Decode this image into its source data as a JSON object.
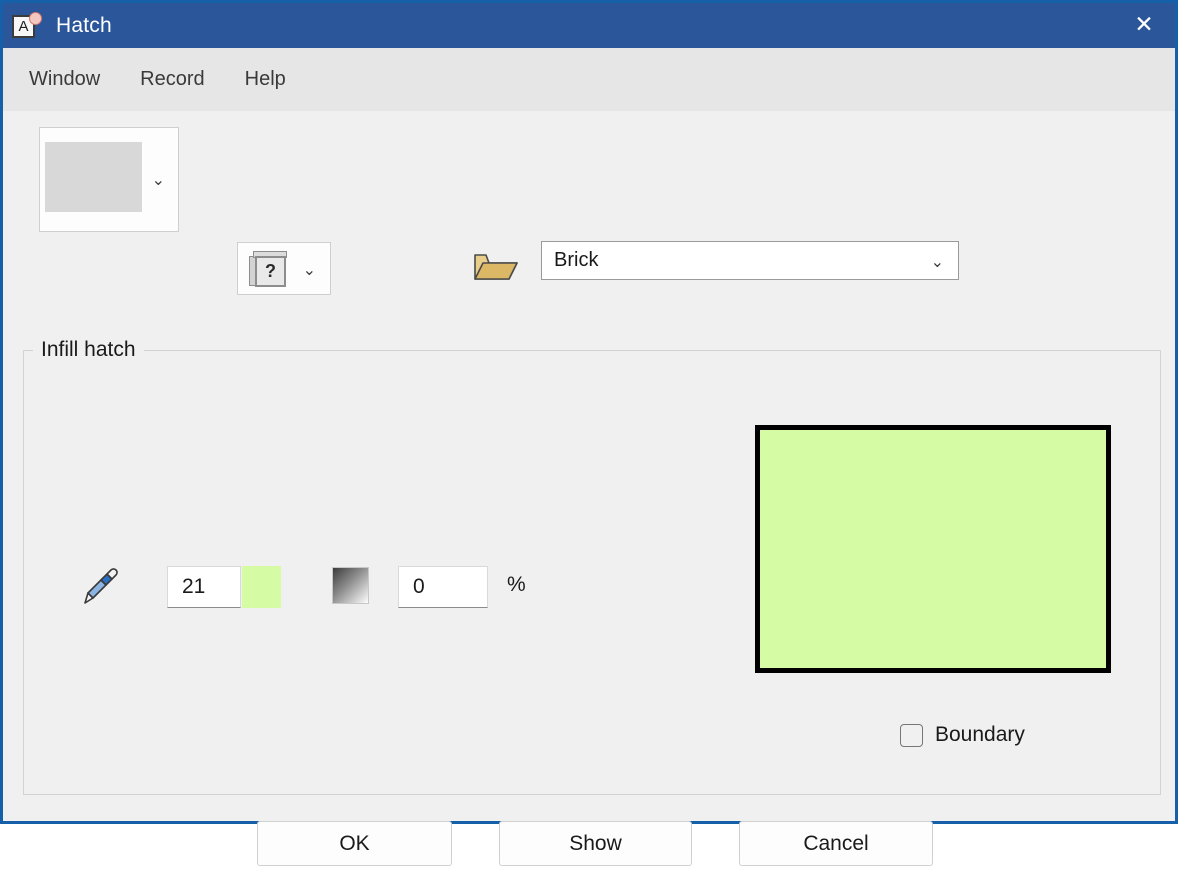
{
  "window": {
    "title": "Hatch",
    "app_icon": "document-a-icon",
    "close_icon": "close-icon",
    "titlebar_color": "#2b579a",
    "border_color": "#1560a8",
    "background_color": "#f0f0f0"
  },
  "menubar": {
    "items": [
      {
        "label": "Window",
        "name": "menu-window"
      },
      {
        "label": "Record",
        "name": "menu-record"
      },
      {
        "label": "Help",
        "name": "menu-help"
      }
    ]
  },
  "toolbar": {
    "pattern_preview_swatch": {
      "icon": "pattern-swatch",
      "color": "#d8d8d8",
      "chevron": "⌄"
    },
    "help_book": {
      "icon": "help-book-icon",
      "glyph": "?",
      "chevron": "⌄"
    },
    "open_folder": {
      "icon": "open-folder-icon",
      "color": "#e0bc6a"
    },
    "pattern_combo": {
      "value": "Brick",
      "chevron": "⌄"
    }
  },
  "infill_group": {
    "legend": "Infill hatch",
    "pencil_icon": "pencil-icon",
    "line_number": {
      "value": "21",
      "name": "line-number-input"
    },
    "line_color": {
      "icon": "color-swatch",
      "color": "#d5fca5"
    },
    "gradient": {
      "icon": "gradient-swatch",
      "from": "#3c3c3c",
      "to": "#fdfdfd"
    },
    "percent_value": {
      "value": "0",
      "name": "percent-input"
    },
    "percent_label": "%",
    "preview": {
      "fill_color": "#d5fca5",
      "border_color": "#000000"
    },
    "boundary_checkbox": {
      "label": "Boundary",
      "checked": false
    }
  },
  "footer": {
    "ok_label": "OK",
    "show_label": "Show",
    "cancel_label": "Cancel"
  }
}
